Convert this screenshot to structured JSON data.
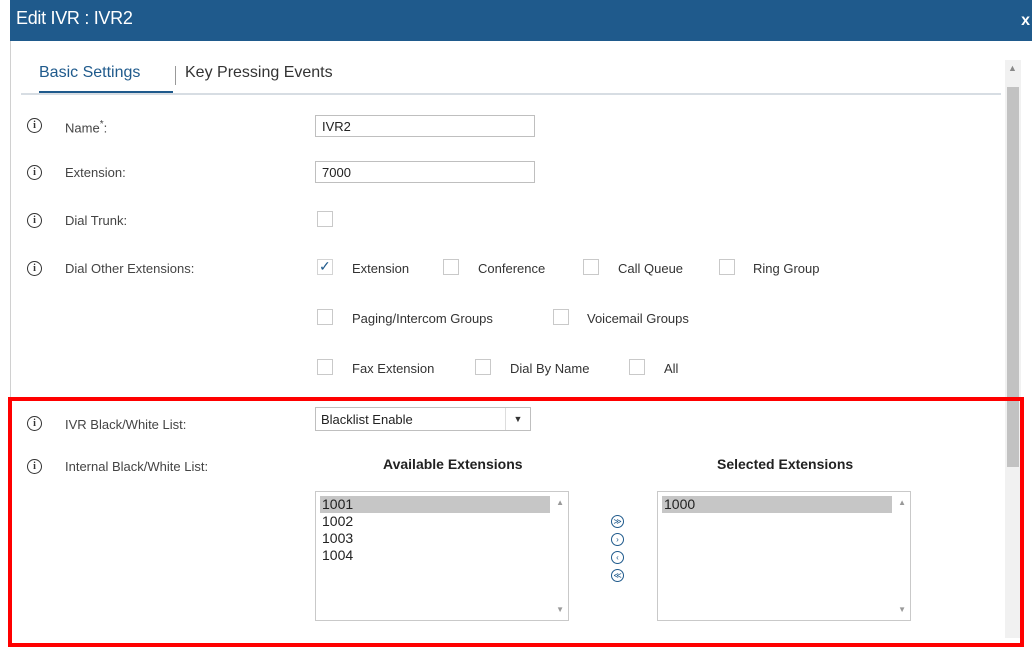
{
  "dialog": {
    "title": "Edit IVR : IVR2",
    "close_label": "x"
  },
  "tabs": [
    {
      "label": "Basic Settings"
    },
    {
      "label": "Key Pressing Events"
    }
  ],
  "info_icon": "i",
  "fields": {
    "name_label": "Name",
    "name_required": "*",
    "name_colon": ":",
    "name_value": "IVR2",
    "extension_label": "Extension:",
    "extension_value": "7000",
    "dial_trunk_label": "Dial Trunk:",
    "dial_other_label": "Dial Other Extensions:",
    "bw_list_label": "IVR Black/White List:",
    "bw_list_value": "Blacklist Enable",
    "internal_bw_label": "Internal Black/White List:"
  },
  "dial_options": [
    {
      "label": "Extension",
      "checked": true
    },
    {
      "label": "Conference",
      "checked": false
    },
    {
      "label": "Call Queue",
      "checked": false
    },
    {
      "label": "Ring Group",
      "checked": false
    },
    {
      "label": "Paging/Intercom Groups",
      "checked": false
    },
    {
      "label": "Voicemail Groups",
      "checked": false
    },
    {
      "label": "Fax Extension",
      "checked": false
    },
    {
      "label": "Dial By Name",
      "checked": false
    },
    {
      "label": "All",
      "checked": false
    }
  ],
  "available": {
    "header": "Available Extensions",
    "items": [
      "1001",
      "1002",
      "1003",
      "1004"
    ],
    "selected_index": 0
  },
  "selected": {
    "header": "Selected Extensions",
    "items": [
      "1000"
    ],
    "selected_index": 0
  },
  "move_buttons": [
    {
      "glyph": "≫",
      "name": "move-all-right-button"
    },
    {
      "glyph": "›",
      "name": "move-right-button"
    },
    {
      "glyph": "‹",
      "name": "move-left-button"
    },
    {
      "glyph": "≪",
      "name": "move-all-left-button"
    }
  ],
  "colors": {
    "accent": "#1f5a8c",
    "highlight_box": "#ff0000"
  }
}
